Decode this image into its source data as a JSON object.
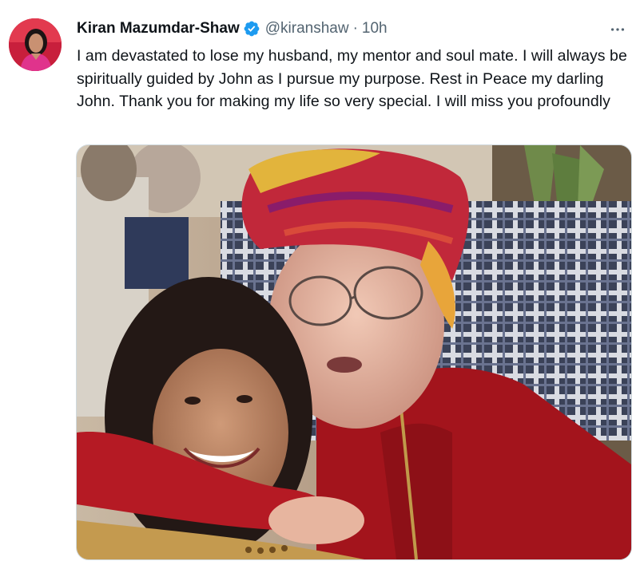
{
  "tweet": {
    "author": {
      "display_name": "Kiran Mazumdar-Shaw",
      "verified": true,
      "handle": "@kiranshaw"
    },
    "separator": "·",
    "timestamp": "10h",
    "text": "I am devastated to lose my husband, my mentor and soul mate. I will always be spiritually guided by John as I pursue my purpose. Rest in Peace my darling John. Thank you for making my life so very special. I will miss you profoundly",
    "more_icon": "more-horizontal-icon",
    "media": {
      "type": "photo"
    }
  },
  "colors": {
    "verified_blue": "#1d9bf0",
    "secondary_text": "#536471",
    "primary_text": "#0f1419"
  }
}
